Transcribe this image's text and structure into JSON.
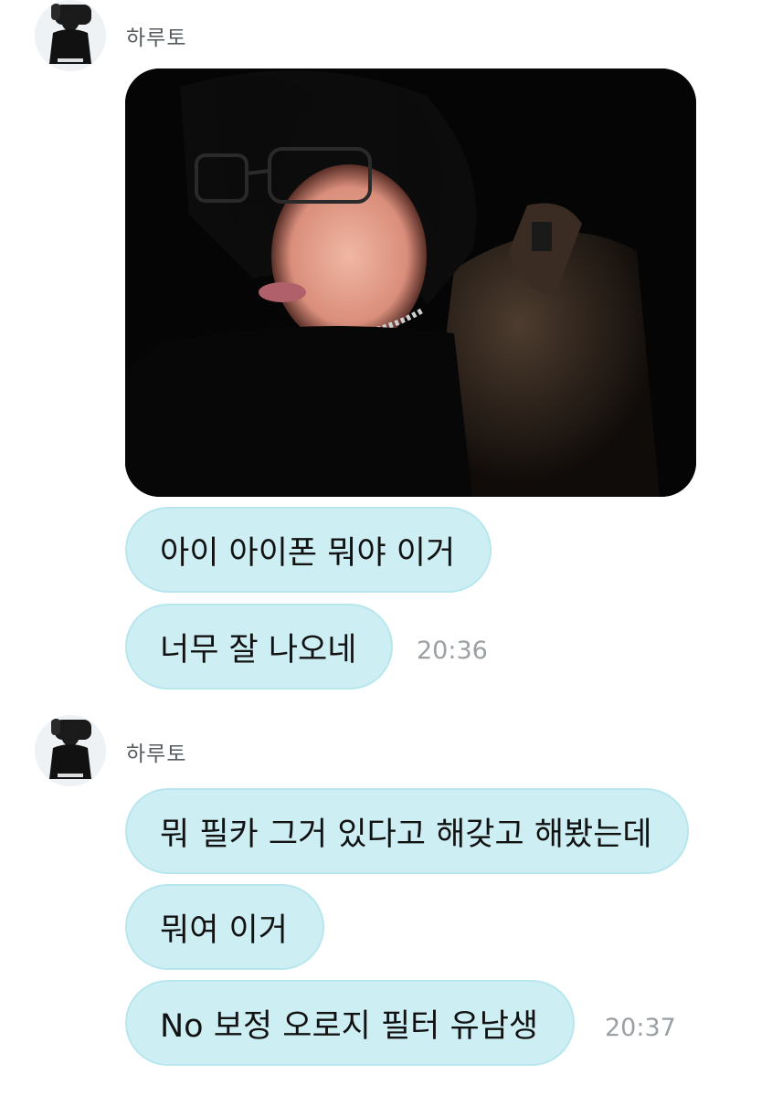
{
  "groups": [
    {
      "sender": "하루토",
      "photo": {
        "alt": ""
      },
      "messages": [
        {
          "text": "아이 아이폰 뭐야 이거"
        },
        {
          "text": "너무 잘 나오네",
          "time": "20:36"
        }
      ]
    },
    {
      "sender": "하루토",
      "messages": [
        {
          "text": "뭐 필카 그거 있다고 해갖고 해봤는데"
        },
        {
          "text": "뭐여 이거"
        },
        {
          "text": "No 보정 오로지 필터 유남생",
          "time": "20:37"
        }
      ]
    }
  ],
  "colors": {
    "bubble_fill": "#cdeff4",
    "bubble_border": "#b7e6ee",
    "timestamp": "#9aa0a4",
    "name": "#555b60"
  },
  "icons": {
    "avatar": "profile-photo-person-black-shirt",
    "photo": "portrait-photo-dark-glasses"
  }
}
